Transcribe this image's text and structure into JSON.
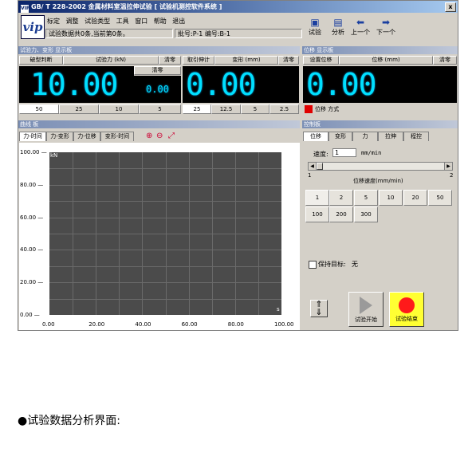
{
  "window": {
    "title": "GB/ T 228-2002 金属材料室温拉伸试验  [ 试验机测控软件系统 ]",
    "logo": "vip",
    "close": "x"
  },
  "menu": [
    "标定",
    "调整",
    "试验类型",
    "工具",
    "窗口",
    "帮助",
    "退出"
  ],
  "status": {
    "records": "试验数据共0条,当前第0条。",
    "batch": "批号:P-1 编号:B-1"
  },
  "toolbar": {
    "test": "试验",
    "analysis": "分析",
    "prev": "上一个",
    "next": "下一个"
  },
  "panel_top": {
    "header": "试验力、变形 显示板",
    "break_label": "破型判断",
    "force_label": "试验力 (kN)",
    "clear": "清零",
    "force_value": "10.00",
    "small_value": "0.00",
    "force_scales": [
      "50",
      "25",
      "10",
      "5"
    ],
    "extensometer_label": "取引伸计",
    "deform_label": "变形 (mm)",
    "deform_value": "0.00",
    "deform_scales": [
      "25",
      "12.5",
      "5",
      "2.5"
    ]
  },
  "panel_disp": {
    "header": "位移 显示板",
    "set_label": "设置位移",
    "disp_label": "位移 (mm)",
    "clear": "清零",
    "value": "0.00",
    "mode": "位移 方式"
  },
  "curve": {
    "header": "曲线 板",
    "tabs": [
      "力-时间",
      "力-变形",
      "力-位移",
      "变形-时间"
    ],
    "unit_y": "kN",
    "unit_x": "s",
    "yticks": [
      "100.00",
      "80.00",
      "60.00",
      "40.00",
      "20.00",
      "0.00"
    ],
    "xticks": [
      "0.00",
      "20.00",
      "40.00",
      "60.00",
      "80.00",
      "100.00"
    ]
  },
  "control": {
    "header": "控制板",
    "tabs": [
      "位移",
      "变形",
      "力",
      "拉伸",
      "程控"
    ],
    "speed_label": "速度:",
    "speed_value": "1",
    "speed_unit": "mm/min",
    "slider_min": "1",
    "slider_max": "2",
    "speed_title": "位移速度(mm/min)",
    "speeds": [
      "1",
      "2",
      "5",
      "10",
      "20",
      "50",
      "100",
      "200",
      "300"
    ],
    "hold_label": "保持目标:",
    "hold_value": "无",
    "start": "试验开始",
    "end": "试验结束"
  },
  "caption": "●试验数据分析界面:"
}
